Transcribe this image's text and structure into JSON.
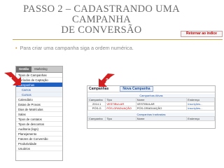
{
  "slide": {
    "title_line1": "Passo 2 – Cadastrando uma campanha",
    "title_line2": "de conversão",
    "back_button": "Retornar ao índice",
    "bullet": "Para criar uma campanha siga a ordem numérica."
  },
  "colors": {
    "accent": "#c9a44c",
    "arrow": "#d21f1f",
    "link": "#1f4f9a"
  },
  "menu": {
    "tabs": [
      {
        "label": "Gestão",
        "active": true
      },
      {
        "label": "Marketing",
        "active": false
      }
    ],
    "items": [
      {
        "label": "Tipos de Campanhas",
        "type": "item"
      },
      {
        "label": "Períodos de Captação",
        "type": "item"
      },
      {
        "label": "Campanhas",
        "type": "selected"
      },
      {
        "label": "Carros",
        "type": "sub"
      },
      {
        "label": "Cursos",
        "type": "sub"
      },
      {
        "label": "Calendário",
        "type": "item"
      },
      {
        "label": "Datas de Provas",
        "type": "item"
      },
      {
        "label": "Dias de Matrículas",
        "type": "item"
      },
      {
        "label": "Salas",
        "type": "item"
      },
      {
        "label": "Tipos de contatos",
        "type": "item"
      },
      {
        "label": "Tipos de descontos",
        "type": "item"
      },
      {
        "label": "Auditoria (logs)",
        "type": "item"
      },
      {
        "label": "Planejamento",
        "type": "item"
      },
      {
        "label": "Fatores de Conversão",
        "type": "item"
      },
      {
        "label": "Produtividade",
        "type": "item"
      },
      {
        "label": "Usuários",
        "type": "item"
      }
    ]
  },
  "panel": {
    "label": "Campanhas",
    "new_button": "Nova Campanha",
    "active_title": "Campanhas Ativas",
    "inactive_title": "Campanhas Inativadas",
    "columns": [
      "Campanha",
      "Tipo",
      "Nome",
      "Endereço"
    ],
    "active_rows": [
      [
        "2014.1",
        "VESTIBULAR",
        "VESTIBULAR",
        "Inscrições..."
      ],
      [
        "PÓS-G",
        "PÓS-GRADUAÇÃO",
        "PÓS-GRADUAÇÃO",
        "Inscrições..."
      ]
    ],
    "inactive_columns": [
      "Campanha",
      "Tipo",
      "Nome",
      "Endereço"
    ]
  },
  "markers": [
    "1",
    "2"
  ]
}
